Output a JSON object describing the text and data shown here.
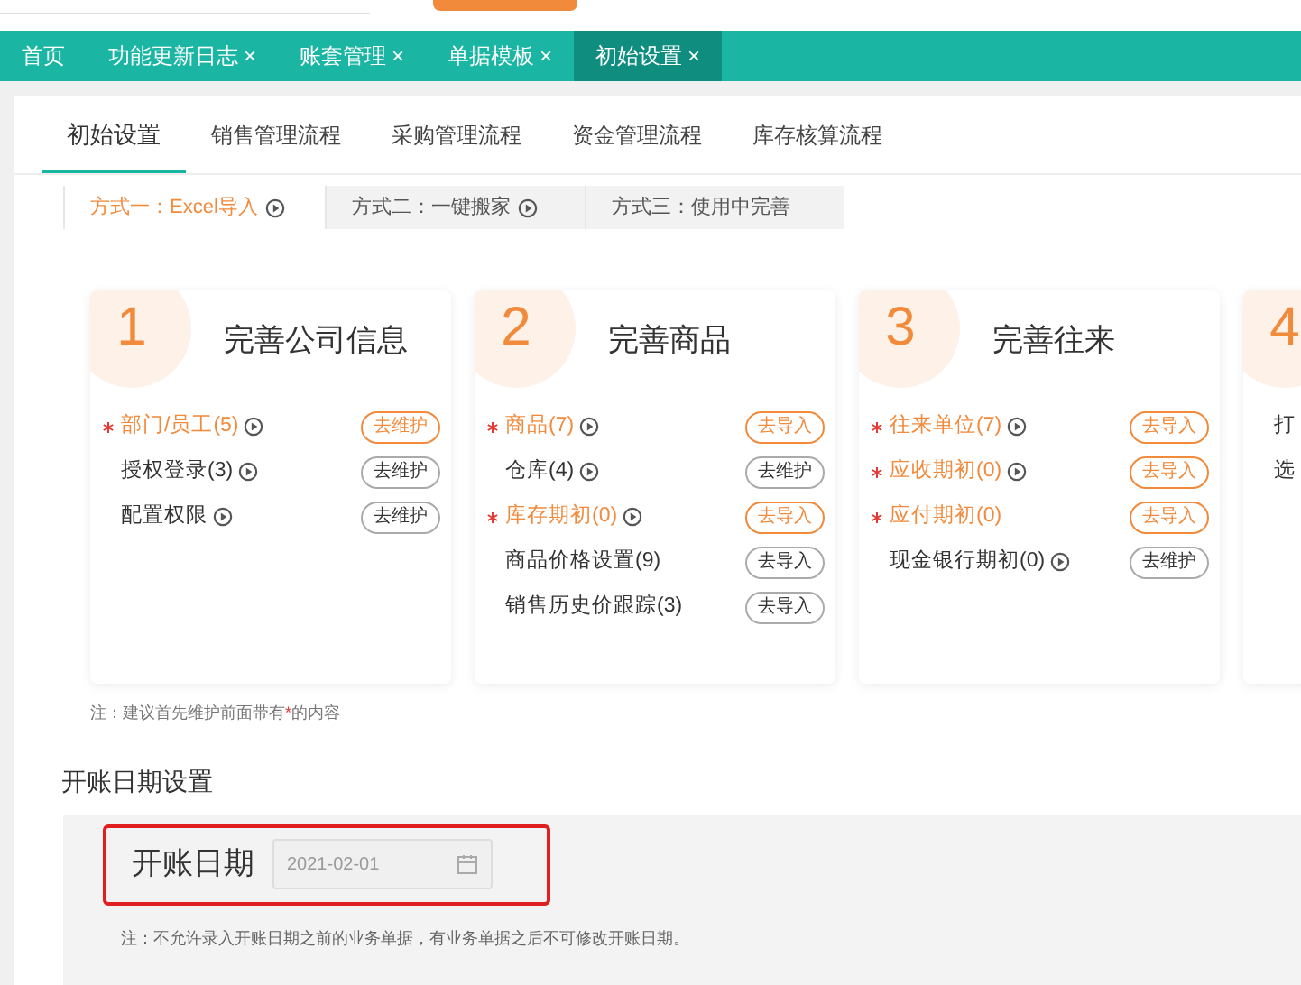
{
  "top_tabs": [
    {
      "label": "首页",
      "closable": false,
      "selected": false
    },
    {
      "label": "功能更新日志",
      "closable": true,
      "selected": false
    },
    {
      "label": "账套管理",
      "closable": true,
      "selected": false
    },
    {
      "label": "单据模板",
      "closable": true,
      "selected": false
    },
    {
      "label": "初始设置",
      "closable": true,
      "selected": true
    }
  ],
  "close_glyph": "×",
  "sub_tabs": [
    {
      "label": "初始设置",
      "selected": true
    },
    {
      "label": "销售管理流程",
      "selected": false
    },
    {
      "label": "采购管理流程",
      "selected": false
    },
    {
      "label": "资金管理流程",
      "selected": false
    },
    {
      "label": "库存核算流程",
      "selected": false
    }
  ],
  "method_tabs": [
    {
      "label": "方式一：Excel导入",
      "video": true,
      "selected": true
    },
    {
      "label": "方式二：一键搬家",
      "video": true,
      "selected": false
    },
    {
      "label": "方式三：使用中完善",
      "video": false,
      "selected": false
    }
  ],
  "cards": [
    {
      "number": "1",
      "title": "完善公司信息",
      "items": [
        {
          "label": "部门/员工(5)",
          "required": true,
          "video": true,
          "button": "去维护"
        },
        {
          "label": "授权登录(3)",
          "required": false,
          "video": true,
          "button": "去维护"
        },
        {
          "label": "配置权限",
          "required": false,
          "video": true,
          "button": "去维护"
        }
      ]
    },
    {
      "number": "2",
      "title": "完善商品",
      "items": [
        {
          "label": "商品(7)",
          "required": true,
          "video": true,
          "button": "去导入"
        },
        {
          "label": "仓库(4)",
          "required": false,
          "video": true,
          "button": "去维护"
        },
        {
          "label": "库存期初(0)",
          "required": true,
          "video": true,
          "button": "去导入"
        },
        {
          "label": "商品价格设置(9)",
          "required": false,
          "video": false,
          "button": "去导入"
        },
        {
          "label": "销售历史价跟踪(3)",
          "required": false,
          "video": false,
          "button": "去导入"
        }
      ]
    },
    {
      "number": "3",
      "title": "完善往来",
      "items": [
        {
          "label": "往来单位(7)",
          "required": true,
          "video": true,
          "button": "去导入"
        },
        {
          "label": "应收期初(0)",
          "required": true,
          "video": true,
          "button": "去导入"
        },
        {
          "label": "应付期初(0)",
          "required": true,
          "video": false,
          "button": "去导入"
        },
        {
          "label": "现金银行期初(0)",
          "required": false,
          "video": true,
          "button": "去维护"
        }
      ]
    },
    {
      "number": "4",
      "items": [
        {
          "label": "打",
          "required": false,
          "video": false
        },
        {
          "label": "选",
          "required": false,
          "video": false
        }
      ]
    }
  ],
  "cards_note": {
    "before": "注：建议首先维护前面带有",
    "mark": "*",
    "after": "的内容"
  },
  "opening_date": {
    "heading": "开账日期设置",
    "label": "开账日期",
    "value": "2021-02-01",
    "highlighted": true,
    "note": "注：不允许录入开账日期之前的业务单据，有业务单据之后不可修改开账日期。"
  }
}
